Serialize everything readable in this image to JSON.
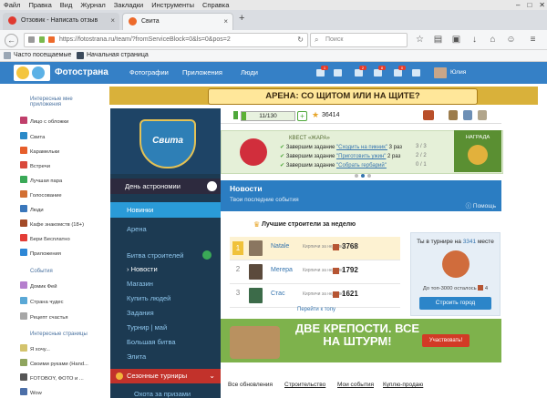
{
  "browser": {
    "menu": [
      "Файл",
      "Правка",
      "Вид",
      "Журнал",
      "Закладки",
      "Инструменты",
      "Справка"
    ],
    "tabs": [
      {
        "title": "Отзовик - Написать отзыв"
      },
      {
        "title": "Свита"
      }
    ],
    "new_tab": "+",
    "url": "https://fotostrana.ru/team/?fromServiceBlock=0&ls=0&pos=2",
    "search_placeholder": "Поиск",
    "bookmarks": [
      "Часто посещаемые",
      "Начальная страница"
    ]
  },
  "site": {
    "logo": "Фотострана",
    "nav": [
      "Фотографии",
      "Приложения",
      "Люди"
    ],
    "badges": [
      "1",
      "2",
      "8",
      "0"
    ],
    "user": "Юлия"
  },
  "sidebar": {
    "sections": [
      {
        "title": "Интересные мне приложения",
        "items": [
          {
            "label": "Лицо с обложки",
            "color": "#c03f6b"
          },
          {
            "label": "Свита",
            "color": "#2a89c8"
          },
          {
            "label": "Карамельки",
            "color": "#e65e2b"
          },
          {
            "label": "Встречи",
            "color": "#d9493c"
          },
          {
            "label": "Лучшая пара",
            "color": "#3aa957"
          },
          {
            "label": "Голосование",
            "color": "#d26f33"
          },
          {
            "label": "Люди",
            "color": "#3a77bb"
          },
          {
            "label": "Кафе знакомств (18+)",
            "color": "#a34a27"
          },
          {
            "label": "Бери Бесплатно",
            "color": "#e33d37"
          },
          {
            "label": "Приложения",
            "color": "#2d87d6"
          }
        ]
      },
      {
        "title": "События",
        "items": [
          {
            "label": "Домик Фей",
            "color": "#b57fcd"
          },
          {
            "label": "Страна чудес",
            "color": "#5aa8d6"
          },
          {
            "label": "Рецепт счастья",
            "color": "#a7a7a7"
          }
        ]
      },
      {
        "title": "Интересные страницы",
        "items": [
          {
            "label": "Я хочу...",
            "color": "#d3c36d"
          },
          {
            "label": "Своими руками (Hand...",
            "color": "#8fa55e"
          },
          {
            "label": "FOTOBOY, ФОТО и ...",
            "color": "#555555"
          },
          {
            "label": "Wow",
            "color": "#4c6fa8"
          }
        ]
      }
    ]
  },
  "arena": {
    "text": "АРЕНА: СО ЩИТОМ ИЛИ НА ЩИТЕ?"
  },
  "game": {
    "logo": "Свита",
    "astro": "День астрономии",
    "menu": [
      "Новинки",
      "Арена",
      "Битва строителей",
      "Новости",
      "Магазин",
      "Купить людей",
      "Задания",
      "Турнир | май",
      "Большая битва",
      "Элита",
      "Сезонные турниры",
      "Охота за призами"
    ],
    "active": "Новости"
  },
  "stats": {
    "energy": "11/130",
    "energy_fraction": 0.085,
    "coins": "36414"
  },
  "quest": {
    "title": "КВЕСТ «ЖАРА»",
    "tasks": [
      {
        "prefix": "Завершим задание ",
        "name": "\"Сходить на пикник\"",
        "suffix": " 3 раз",
        "progress": "3 / 3"
      },
      {
        "prefix": "Завершим задание ",
        "name": "\"Приготовить ужин\"",
        "suffix": " 2 раз",
        "progress": "2 / 2"
      },
      {
        "prefix": "Завершим задание ",
        "name": "\"Собрать гербарий\"",
        "suffix": "",
        "progress": "0 / 1"
      }
    ],
    "reward": "НАГРАДА"
  },
  "news": {
    "title": "Новости",
    "subtitle": "Твои последние события",
    "help": "Помощь"
  },
  "builders": {
    "title": "Лучшие строители за неделю",
    "rows": [
      {
        "rank": "1",
        "name": "Natale",
        "label": "Кирпичи за неделю",
        "value": "3768"
      },
      {
        "rank": "2",
        "name": "Мегера",
        "label": "Кирпичи за неделю",
        "value": "1792"
      },
      {
        "rank": "3",
        "name": "Стас",
        "label": "Кирпичи за неделю",
        "value": "1621"
      }
    ],
    "more": "Перейти к топу",
    "tournament_prefix": "Ты в турнире на ",
    "tournament_place": "3341",
    "tournament_suffix": " месте",
    "tournament_top": "До топ-3000 осталось",
    "tournament_left": "4",
    "build_button": "Строить город"
  },
  "storm": {
    "text": "ДВЕ КРЕПОСТИ. ВСЕ НА ШТУРМ!",
    "button": "Участвовать!"
  },
  "bottom_tabs": [
    "Все обновления",
    "Строительство",
    "Мои события",
    "Куплю-продаю"
  ]
}
